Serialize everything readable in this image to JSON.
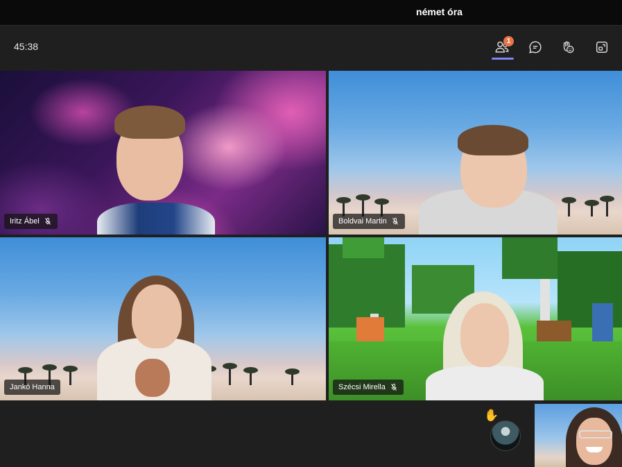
{
  "meeting": {
    "title": "német óra",
    "timer": "45:38"
  },
  "toolbar": {
    "participants_badge": "1",
    "buttons": [
      "participants-icon",
      "chat-icon",
      "reactions-icon",
      "share-tray-icon"
    ]
  },
  "participants": [
    {
      "name": "Iritz Ábel",
      "muted": true
    },
    {
      "name": "Boldvai Martin",
      "muted": true
    },
    {
      "name": "Jankó Hanna",
      "muted": false
    },
    {
      "name": "Szécsi Mirella",
      "muted": true
    }
  ],
  "self_view": {
    "hand_raised": true
  }
}
